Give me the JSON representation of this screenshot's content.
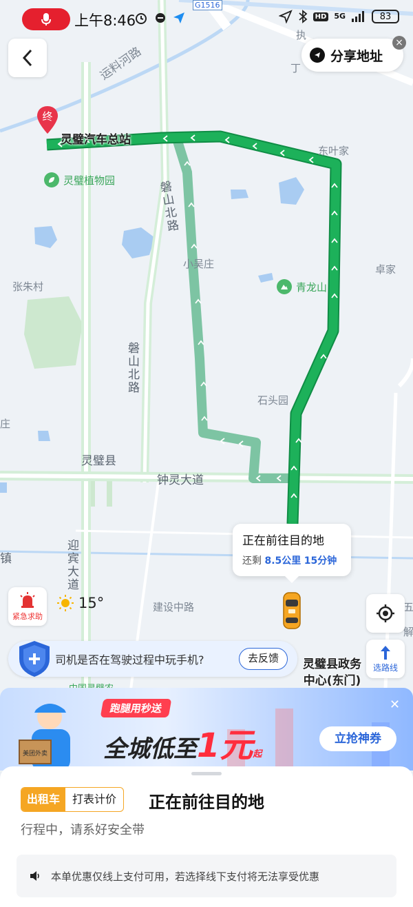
{
  "status_bar": {
    "time": "上午8:46",
    "network": "5G",
    "hd": "HD",
    "battery": "83"
  },
  "share": {
    "label": "分享地址"
  },
  "map": {
    "start_station": "灵璧汽车总站",
    "end_marker": "终",
    "labels": {
      "g1516": "G1516",
      "canal_road": "运料河路",
      "ding": "丁",
      "dongyejia": "东叶家",
      "botanical": "灵璧植物园",
      "panshan_n1": "磐山北路",
      "panshan_n2": "磐山北路",
      "xiaowuzhuang": "小吴庄",
      "zhujia": "卓家",
      "zhangzhucun": "张朱村",
      "qinglongshan": "青龙山",
      "shitouyuan": "石头园",
      "zhuang": "庄",
      "lingbi_county": "灵璧县",
      "zhongling_ave": "钟灵大道",
      "zhen": "镇",
      "yingbin_ave": "迎宾大道",
      "jianshe_mid": "建设中路",
      "wu": "五",
      "xie": "解",
      "top_partial": "执",
      "bottom_partial": "中国灵璧农"
    }
  },
  "trip_bubble": {
    "title": "正在前往目的地",
    "prefix": "还剩",
    "distance": "8.5公里",
    "duration": "15分钟"
  },
  "sos": {
    "label": "紧急求助"
  },
  "weather": {
    "temp": "15°"
  },
  "route_select": {
    "label": "选路线"
  },
  "feedback": {
    "question": "司机是否在驾驶过程中玩手机?",
    "button": "去反馈"
  },
  "destination": {
    "line1": "灵璧县政务",
    "line2": "中心(东门)"
  },
  "promo": {
    "tag": "跑腿用秒送",
    "headline_pre": "全城低至",
    "headline_num": "1元",
    "headline_suffix": "起",
    "button": "立抢神券",
    "box_text": "美团外卖"
  },
  "sheet": {
    "tag_taxi": "出租车",
    "tag_meter": "打表计价",
    "title": "正在前往目的地",
    "subtitle": "行程中，请系好安全带",
    "notice": "本单优惠仅线上支付可用，若选择线下支付将无法享受优惠"
  },
  "colors": {
    "route": "#1db15a",
    "alt_route": "#7dc4a3",
    "accent": "#2b66d9",
    "taxi": "#f5a623",
    "sos": "#e33333"
  }
}
